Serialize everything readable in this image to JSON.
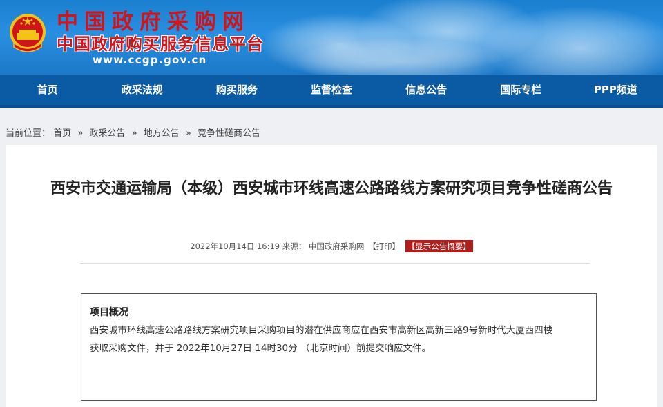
{
  "header": {
    "site_title": "中国政府采购网",
    "platform_title": "中国政府购买服务信息平台",
    "url": "www.ccgp.gov.cn",
    "emblem_icon": "national-emblem-icon"
  },
  "nav": {
    "items": [
      "首页",
      "政采法规",
      "购买服务",
      "监督检查",
      "信息公告",
      "国际专栏",
      "PPP频道"
    ]
  },
  "breadcrumb": {
    "prefix": "当前位置：",
    "items": [
      "首页",
      "政采公告",
      "地方公告",
      "竞争性磋商公告"
    ],
    "separator": "»"
  },
  "article": {
    "title": "西安市交通运输局（本级）西安城市环线高速公路路线方案研究项目竞争性磋商公告",
    "meta_date": "2022年10月14日 16:19",
    "meta_source_label": "来源：",
    "meta_source": "中国政府采购网",
    "print_label": "【打印】",
    "summary_button": "【显示公告概要】"
  },
  "overview": {
    "heading": "项目概况",
    "line1": "西安城市环线高速公路路线方案研究项目采购项目的潜在供应商应在西安市高新区高新三路9号新时代大厦西四楼",
    "line2": "获取采购文件，并于 2022年10月27日 14时30分 （北京时间）前提交响应文件。"
  },
  "colors": {
    "banner_blue": "#1b7fd0",
    "nav_blue": "#0b5aa4",
    "title_red": "#d0141b",
    "summary_red": "#b01d1d"
  }
}
